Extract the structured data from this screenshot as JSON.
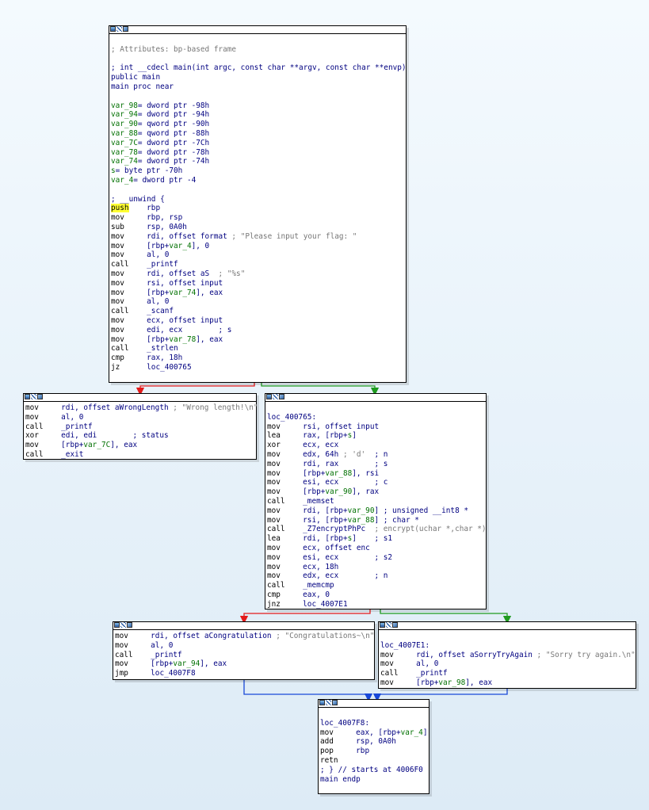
{
  "colors": {
    "branch_false": "#e31a1a",
    "branch_true": "#1f9a1f",
    "unconditional": "#1848d8",
    "operand_name": "#000080",
    "variable_name": "#007000",
    "comment": "#777777",
    "highlight": "#ffff33"
  },
  "header_icons": [
    "graph-overview-icon",
    "pencil-edit-icon",
    "color-palette-icon"
  ],
  "nodes": [
    {
      "id": "main",
      "lines": [
        [],
        [
          {
            "t": "; Attributes: bp-based frame",
            "c": "cmt"
          }
        ],
        [],
        [
          {
            "t": "; int __cdecl main(int argc, const char **argv, const char **envp)",
            "c": "blu"
          }
        ],
        [
          {
            "t": "public main",
            "c": "blu"
          }
        ],
        [
          {
            "t": "main proc near",
            "c": "blu"
          }
        ],
        [],
        [
          {
            "t": "var_98",
            "c": "grn"
          },
          {
            "t": "= dword ptr -98h",
            "c": "blu"
          }
        ],
        [
          {
            "t": "var_94",
            "c": "grn"
          },
          {
            "t": "= dword ptr -94h",
            "c": "blu"
          }
        ],
        [
          {
            "t": "var_90",
            "c": "grn"
          },
          {
            "t": "= qword ptr -90h",
            "c": "blu"
          }
        ],
        [
          {
            "t": "var_88",
            "c": "grn"
          },
          {
            "t": "= qword ptr -88h",
            "c": "blu"
          }
        ],
        [
          {
            "t": "var_7C",
            "c": "grn"
          },
          {
            "t": "= dword ptr -7Ch",
            "c": "blu"
          }
        ],
        [
          {
            "t": "var_78",
            "c": "grn"
          },
          {
            "t": "= dword ptr -78h",
            "c": "blu"
          }
        ],
        [
          {
            "t": "var_74",
            "c": "grn"
          },
          {
            "t": "= dword ptr -74h",
            "c": "blu"
          }
        ],
        [
          {
            "t": "s",
            "c": "grn"
          },
          {
            "t": "= byte ptr -70h",
            "c": "blu"
          }
        ],
        [
          {
            "t": "var_4",
            "c": "grn"
          },
          {
            "t": "= dword ptr -4",
            "c": "blu"
          }
        ],
        [],
        [
          {
            "t": "; __unwind {",
            "c": "blu"
          }
        ],
        [
          {
            "t": "push",
            "c": "hl"
          },
          {
            "t": "    rbp",
            "c": "blu"
          }
        ],
        [
          {
            "t": "mov     "
          },
          {
            "t": "rbp, rsp",
            "c": "blu"
          }
        ],
        [
          {
            "t": "sub     "
          },
          {
            "t": "rsp, 0A0h",
            "c": "blu"
          }
        ],
        [
          {
            "t": "mov     "
          },
          {
            "t": "rdi, offset format",
            "c": "blu"
          },
          {
            "t": " ; \"Please input your flag: \"",
            "c": "cmt"
          }
        ],
        [
          {
            "t": "mov     "
          },
          {
            "t": "[rbp+",
            "c": "blu"
          },
          {
            "t": "var_4",
            "c": "grn"
          },
          {
            "t": "], 0",
            "c": "blu"
          }
        ],
        [
          {
            "t": "mov     "
          },
          {
            "t": "al, 0",
            "c": "blu"
          }
        ],
        [
          {
            "t": "call    "
          },
          {
            "t": "_printf",
            "c": "blu"
          }
        ],
        [
          {
            "t": "mov     "
          },
          {
            "t": "rdi, offset aS",
            "c": "blu"
          },
          {
            "t": "  ; \"%s\"",
            "c": "cmt"
          }
        ],
        [
          {
            "t": "mov     "
          },
          {
            "t": "rsi, offset input",
            "c": "blu"
          }
        ],
        [
          {
            "t": "mov     "
          },
          {
            "t": "[rbp+",
            "c": "blu"
          },
          {
            "t": "var_74",
            "c": "grn"
          },
          {
            "t": "], eax",
            "c": "blu"
          }
        ],
        [
          {
            "t": "mov     "
          },
          {
            "t": "al, 0",
            "c": "blu"
          }
        ],
        [
          {
            "t": "call    "
          },
          {
            "t": "_scanf",
            "c": "blu"
          }
        ],
        [
          {
            "t": "mov     "
          },
          {
            "t": "ecx, offset input",
            "c": "blu"
          }
        ],
        [
          {
            "t": "mov     "
          },
          {
            "t": "edi, ecx",
            "c": "blu"
          },
          {
            "t": "        ; s",
            "c": "blu"
          }
        ],
        [
          {
            "t": "mov     "
          },
          {
            "t": "[rbp+",
            "c": "blu"
          },
          {
            "t": "var_78",
            "c": "grn"
          },
          {
            "t": "], eax",
            "c": "blu"
          }
        ],
        [
          {
            "t": "call    "
          },
          {
            "t": "_strlen",
            "c": "blu"
          }
        ],
        [
          {
            "t": "cmp     "
          },
          {
            "t": "rax, 18h",
            "c": "blu"
          }
        ],
        [
          {
            "t": "jz      "
          },
          {
            "t": "loc_400765",
            "c": "blu"
          }
        ]
      ]
    },
    {
      "id": "wrong",
      "lines": [
        [
          {
            "t": "mov     "
          },
          {
            "t": "rdi, offset aWrongLength",
            "c": "blu"
          },
          {
            "t": " ; \"Wrong length!\\n\"",
            "c": "cmt"
          }
        ],
        [
          {
            "t": "mov     "
          },
          {
            "t": "al, 0",
            "c": "blu"
          }
        ],
        [
          {
            "t": "call    "
          },
          {
            "t": "_printf",
            "c": "blu"
          }
        ],
        [
          {
            "t": "xor     "
          },
          {
            "t": "edi, edi",
            "c": "blu"
          },
          {
            "t": "        ; status",
            "c": "blu"
          }
        ],
        [
          {
            "t": "mov     "
          },
          {
            "t": "[rbp+",
            "c": "blu"
          },
          {
            "t": "var_7C",
            "c": "grn"
          },
          {
            "t": "], eax",
            "c": "blu"
          }
        ],
        [
          {
            "t": "call    "
          },
          {
            "t": "_exit",
            "c": "blu"
          }
        ]
      ]
    },
    {
      "id": "loc400765",
      "lines": [
        [],
        [
          {
            "t": "loc_400765:",
            "c": "blu"
          }
        ],
        [
          {
            "t": "mov     "
          },
          {
            "t": "rsi, offset input",
            "c": "blu"
          }
        ],
        [
          {
            "t": "lea     "
          },
          {
            "t": "rax, [rbp+",
            "c": "blu"
          },
          {
            "t": "s",
            "c": "grn"
          },
          {
            "t": "]",
            "c": "blu"
          }
        ],
        [
          {
            "t": "xor     "
          },
          {
            "t": "ecx, ecx",
            "c": "blu"
          }
        ],
        [
          {
            "t": "mov     "
          },
          {
            "t": "edx, 64h",
            "c": "blu"
          },
          {
            "t": " ; 'd'",
            "c": "cmt"
          },
          {
            "t": "  ; n",
            "c": "blu"
          }
        ],
        [
          {
            "t": "mov     "
          },
          {
            "t": "rdi, rax",
            "c": "blu"
          },
          {
            "t": "        ; s",
            "c": "blu"
          }
        ],
        [
          {
            "t": "mov     "
          },
          {
            "t": "[rbp+",
            "c": "blu"
          },
          {
            "t": "var_88",
            "c": "grn"
          },
          {
            "t": "], rsi",
            "c": "blu"
          }
        ],
        [
          {
            "t": "mov     "
          },
          {
            "t": "esi, ecx",
            "c": "blu"
          },
          {
            "t": "        ; c",
            "c": "blu"
          }
        ],
        [
          {
            "t": "mov     "
          },
          {
            "t": "[rbp+",
            "c": "blu"
          },
          {
            "t": "var_90",
            "c": "grn"
          },
          {
            "t": "], rax",
            "c": "blu"
          }
        ],
        [
          {
            "t": "call    "
          },
          {
            "t": "_memset",
            "c": "blu"
          }
        ],
        [
          {
            "t": "mov     "
          },
          {
            "t": "rdi, [rbp+",
            "c": "blu"
          },
          {
            "t": "var_90",
            "c": "grn"
          },
          {
            "t": "] ; unsigned __int8 *",
            "c": "blu"
          }
        ],
        [
          {
            "t": "mov     "
          },
          {
            "t": "rsi, [rbp+",
            "c": "blu"
          },
          {
            "t": "var_88",
            "c": "grn"
          },
          {
            "t": "] ; char *",
            "c": "blu"
          }
        ],
        [
          {
            "t": "call    "
          },
          {
            "t": "_Z7encryptPhPc",
            "c": "blu"
          },
          {
            "t": "  ; encrypt(uchar *,char *)",
            "c": "cmt"
          }
        ],
        [
          {
            "t": "lea     "
          },
          {
            "t": "rdi, [rbp+",
            "c": "blu"
          },
          {
            "t": "s",
            "c": "grn"
          },
          {
            "t": "]",
            "c": "blu"
          },
          {
            "t": "    ; s1",
            "c": "blu"
          }
        ],
        [
          {
            "t": "mov     "
          },
          {
            "t": "ecx, offset enc",
            "c": "blu"
          }
        ],
        [
          {
            "t": "mov     "
          },
          {
            "t": "esi, ecx",
            "c": "blu"
          },
          {
            "t": "        ; s2",
            "c": "blu"
          }
        ],
        [
          {
            "t": "mov     "
          },
          {
            "t": "ecx, 18h",
            "c": "blu"
          }
        ],
        [
          {
            "t": "mov     "
          },
          {
            "t": "edx, ecx",
            "c": "blu"
          },
          {
            "t": "        ; n",
            "c": "blu"
          }
        ],
        [
          {
            "t": "call    "
          },
          {
            "t": "_memcmp",
            "c": "blu"
          }
        ],
        [
          {
            "t": "cmp     "
          },
          {
            "t": "eax, 0",
            "c": "blu"
          }
        ],
        [
          {
            "t": "jnz     "
          },
          {
            "t": "loc_4007E1",
            "c": "blu"
          }
        ]
      ]
    },
    {
      "id": "congrats",
      "lines": [
        [
          {
            "t": "mov     "
          },
          {
            "t": "rdi, offset aCongratulation",
            "c": "blu"
          },
          {
            "t": " ; \"Congratulations~\\n\"",
            "c": "cmt"
          }
        ],
        [
          {
            "t": "mov     "
          },
          {
            "t": "al, 0",
            "c": "blu"
          }
        ],
        [
          {
            "t": "call    "
          },
          {
            "t": "_printf",
            "c": "blu"
          }
        ],
        [
          {
            "t": "mov     "
          },
          {
            "t": "[rbp+",
            "c": "blu"
          },
          {
            "t": "var_94",
            "c": "grn"
          },
          {
            "t": "], eax",
            "c": "blu"
          }
        ],
        [
          {
            "t": "jmp     "
          },
          {
            "t": "loc_4007F8",
            "c": "blu"
          }
        ]
      ]
    },
    {
      "id": "sorry",
      "lines": [
        [],
        [
          {
            "t": "loc_4007E1:",
            "c": "blu"
          }
        ],
        [
          {
            "t": "mov     "
          },
          {
            "t": "rdi, offset aSorryTryAgain",
            "c": "blu"
          },
          {
            "t": " ; \"Sorry try again.\\n\"",
            "c": "cmt"
          }
        ],
        [
          {
            "t": "mov     "
          },
          {
            "t": "al, 0",
            "c": "blu"
          }
        ],
        [
          {
            "t": "call    "
          },
          {
            "t": "_printf",
            "c": "blu"
          }
        ],
        [
          {
            "t": "mov     "
          },
          {
            "t": "[rbp+",
            "c": "blu"
          },
          {
            "t": "var_98",
            "c": "grn"
          },
          {
            "t": "], eax",
            "c": "blu"
          }
        ]
      ]
    },
    {
      "id": "end",
      "lines": [
        [],
        [
          {
            "t": "loc_4007F8:",
            "c": "blu"
          }
        ],
        [
          {
            "t": "mov     "
          },
          {
            "t": "eax, [rbp+",
            "c": "blu"
          },
          {
            "t": "var_4",
            "c": "grn"
          },
          {
            "t": "]",
            "c": "blu"
          }
        ],
        [
          {
            "t": "add     "
          },
          {
            "t": "rsp, 0A0h",
            "c": "blu"
          }
        ],
        [
          {
            "t": "pop     "
          },
          {
            "t": "rbp",
            "c": "blu"
          }
        ],
        [
          {
            "t": "retn"
          }
        ],
        [
          {
            "t": "; } // starts at 4006F0",
            "c": "blu"
          }
        ],
        [
          {
            "t": "main endp",
            "c": "blu"
          }
        ]
      ]
    }
  ]
}
